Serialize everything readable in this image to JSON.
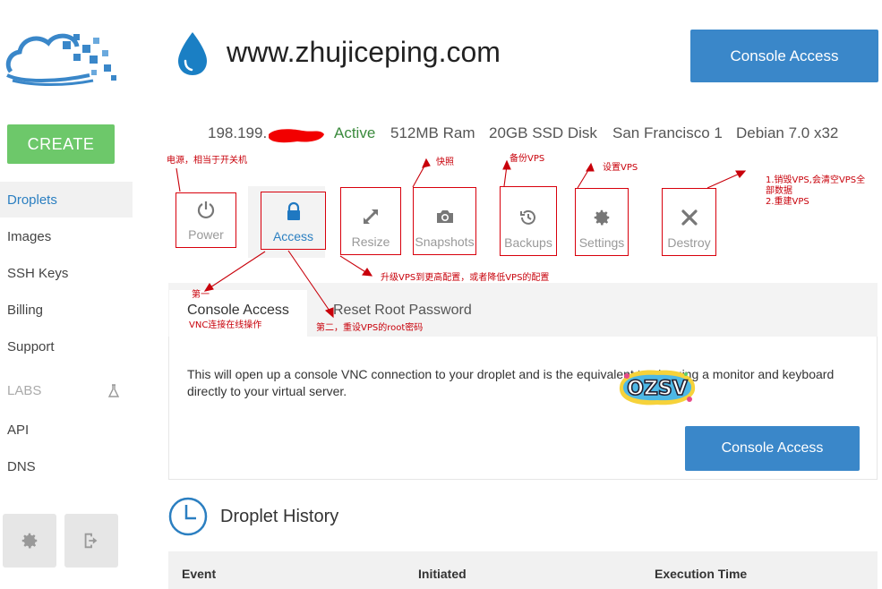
{
  "sidebar": {
    "create_label": "CREATE",
    "items": [
      {
        "label": "Droplets",
        "active": true
      },
      {
        "label": "Images"
      },
      {
        "label": "SSH Keys"
      },
      {
        "label": "Billing"
      },
      {
        "label": "Support"
      },
      {
        "label": "LABS"
      },
      {
        "label": "API"
      },
      {
        "label": "DNS"
      }
    ],
    "labs_icon": "flask-icon",
    "footer_icons": [
      "gear-icon",
      "logout-icon"
    ]
  },
  "header": {
    "title": "www.zhujiceping.com",
    "console_button": "Console Access"
  },
  "info": {
    "ip": "198.199.",
    "status": "Active",
    "ram": "512MB Ram",
    "disk": "20GB SSD Disk",
    "region": "San Francisco 1",
    "os": "Debian 7.0 x32"
  },
  "tabs": [
    {
      "label": "Power",
      "icon": "power-icon"
    },
    {
      "label": "Access",
      "icon": "lock-icon",
      "active": true
    },
    {
      "label": "Resize",
      "icon": "resize-icon"
    },
    {
      "label": "Snapshots",
      "icon": "camera-icon"
    },
    {
      "label": "Backups",
      "icon": "history-icon"
    },
    {
      "label": "Settings",
      "icon": "gear-icon"
    },
    {
      "label": "Destroy",
      "icon": "close-icon"
    }
  ],
  "access": {
    "subtabs": [
      "Console Access",
      "Reset Root Password"
    ],
    "description": "This will open up a console VNC connection to your droplet and is the equivalent to plugging a monitor and keyboard directly to your virtual server.",
    "button": "Console Access"
  },
  "history": {
    "title": "Droplet History",
    "columns": [
      "Event",
      "Initiated",
      "Execution Time"
    ]
  },
  "annotations": {
    "power": "电源，相当于开关机",
    "snapshot": "快照",
    "backup": "备份VPS",
    "settings": "设置VPS",
    "destroy_1": "1.销毁VPS,会清空VPS全",
    "destroy_2": "部数据",
    "destroy_3": "2.重建VPS",
    "resize": "升级VPS到更高配置，或者降低VPS的配置",
    "first": "第一",
    "vnc": "VNC连接在线操作",
    "second": "第二，重设VPS的root密码"
  },
  "watermark": "OZSV",
  "colors": {
    "primary": "#3a87c9",
    "create": "#6dc86a",
    "active_status": "#3a8a3c",
    "annotation": "#c8000a"
  }
}
